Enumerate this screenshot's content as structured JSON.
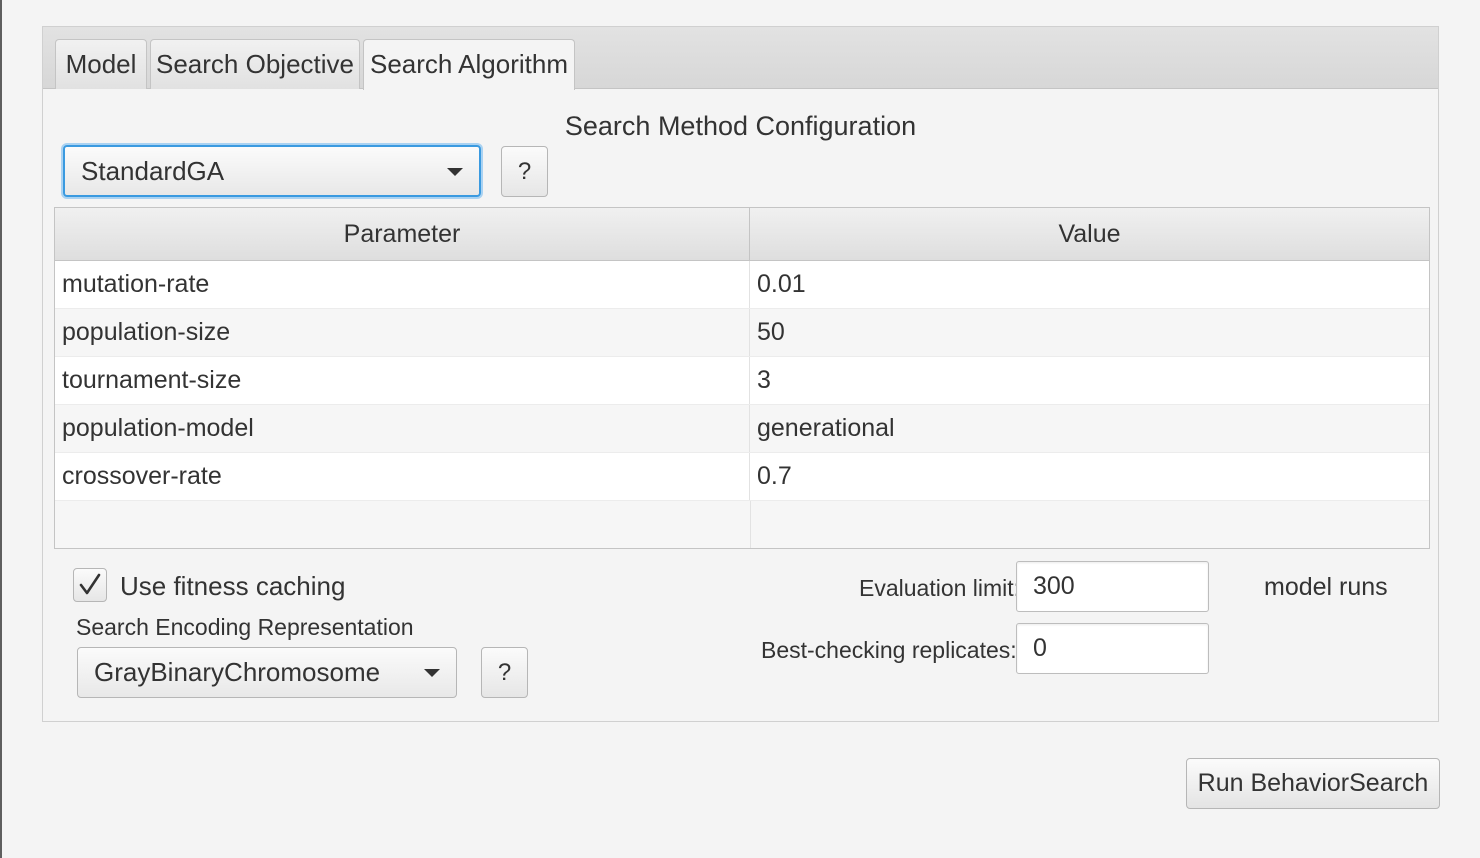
{
  "tabs": [
    {
      "label": "Model",
      "selected": false
    },
    {
      "label": "Search Objective",
      "selected": false
    },
    {
      "label": "Search Algorithm",
      "selected": true
    }
  ],
  "search_method": {
    "title": "Search Method Configuration",
    "selected": "StandardGA",
    "help_label": "?",
    "focus_color": "#3a9ae0"
  },
  "parameter_table": {
    "headers": {
      "parameter": "Parameter",
      "value": "Value"
    },
    "rows": [
      {
        "parameter": "mutation-rate",
        "value": "0.01"
      },
      {
        "parameter": "population-size",
        "value": "50"
      },
      {
        "parameter": "tournament-size",
        "value": "3"
      },
      {
        "parameter": "population-model",
        "value": "generational"
      },
      {
        "parameter": "crossover-rate",
        "value": "0.7"
      }
    ]
  },
  "fitness_caching": {
    "label": "Use fitness caching",
    "checked": true,
    "icon": "checkmark-icon"
  },
  "encoding": {
    "label": "Search Encoding Representation",
    "selected": "GrayBinaryChromosome",
    "help_label": "?"
  },
  "evaluation": {
    "label": "Evaluation limit:",
    "value": "300",
    "units": "model runs"
  },
  "best_checking": {
    "label": "Best-checking replicates:",
    "value": "0"
  },
  "run_button": {
    "label": "Run BehaviorSearch"
  }
}
